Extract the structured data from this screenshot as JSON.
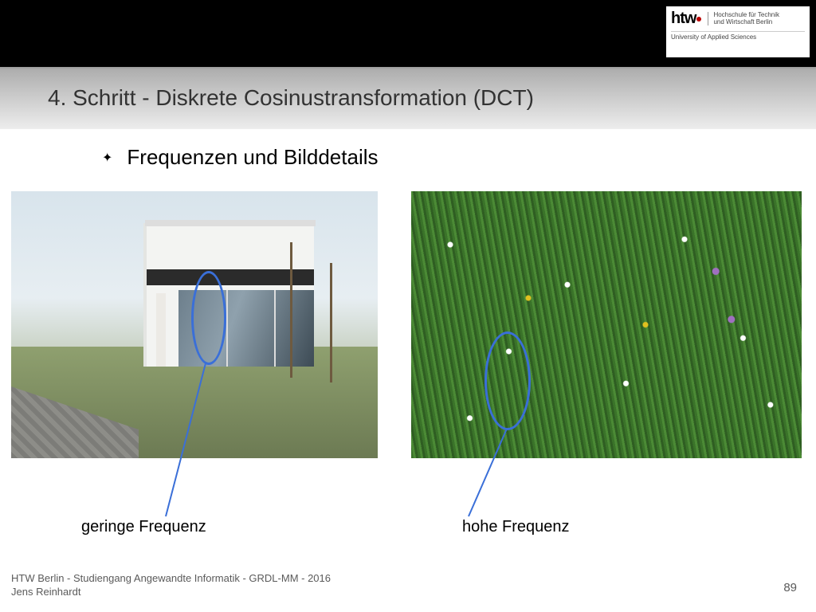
{
  "logo": {
    "brand": "htw",
    "line1": "Hochschule für Technik",
    "line2": "und Wirtschaft Berlin",
    "sub": "University of Applied Sciences"
  },
  "title": "4. Schritt - Diskrete Cosinustransformation (DCT)",
  "bullet": {
    "glyph": "✦",
    "text": "Frequenzen und Bilddetails"
  },
  "captions": {
    "left": "geringe Frequenz",
    "right": "hohe Frequenz"
  },
  "annotations": {
    "ellipse_color": "#3a6fd8"
  },
  "footer": {
    "line1": "HTW Berlin - Studiengang Angewandte Informatik - GRDL-MM - 2016",
    "line2": "Jens Reinhardt"
  },
  "page_number": "89"
}
